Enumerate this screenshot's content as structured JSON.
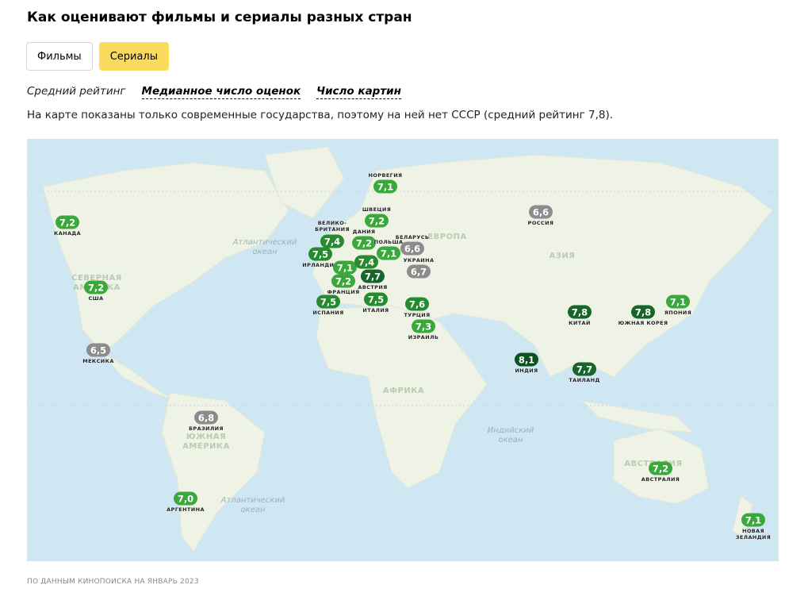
{
  "title": "Как оценивают фильмы и сериалы разных стран",
  "tabs": [
    {
      "label": "Фильмы",
      "active": false
    },
    {
      "label": "Сериалы",
      "active": true
    }
  ],
  "metrics": [
    {
      "label": "Средний рейтинг",
      "current": true
    },
    {
      "label": "Медианное число оценок",
      "current": false
    },
    {
      "label": "Число картин",
      "current": false
    }
  ],
  "note": "На карте показаны только современные государства, поэтому на ней нет СССР (средний рейтинг 7,8).",
  "source": "ПО ДАННЫМ КИНОПОИСКА НА ЯНВАРЬ 2023",
  "colors": {
    "low": "#8c8c8c",
    "mid": "#3ba83b",
    "high": "#268a2e",
    "top": "#17652a",
    "max": "#0f5222"
  },
  "map_labels": {
    "atlantic_n": "Атлантический\nокеан",
    "atlantic_s": "Атлантический\nокеан",
    "indian": "Индийский\nокеан",
    "europe": "ЕВРОПА",
    "asia": "АЗИЯ",
    "africa": "АФРИКА",
    "n_america": "СЕВЕРНАЯ\nАМЕРИКА",
    "s_america": "ЮЖНАЯ\nАМЕРИКА",
    "australia_c": "АВСТРАЛИЯ"
  },
  "countries": [
    {
      "id": "norway",
      "name": "НОРВЕГИЯ",
      "rating": "7,1"
    },
    {
      "id": "canada",
      "name": "КАНАДА",
      "rating": "7,2"
    },
    {
      "id": "sweden",
      "name": "ШВЕЦИЯ",
      "rating": "7,2"
    },
    {
      "id": "russia",
      "name": "РОССИЯ",
      "rating": "6,6"
    },
    {
      "id": "uk",
      "name": "ВЕЛИКО-\nБРИТАНИЯ",
      "rating": "7,4"
    },
    {
      "id": "denmark",
      "name": "ДАНИЯ",
      "rating": "7,2"
    },
    {
      "id": "poland",
      "name": "ПОЛЬША",
      "rating": "7,1"
    },
    {
      "id": "belarus",
      "name": "БЕЛАРУСЬ",
      "rating": "6,6"
    },
    {
      "id": "ireland",
      "name": "ИРЛАНДИЯ",
      "rating": "7,5"
    },
    {
      "id": "ukraine",
      "name": "УКРАИНА",
      "rating": "6,7"
    },
    {
      "id": "belgium",
      "name": "",
      "rating": "7,1"
    },
    {
      "id": "germany",
      "name": "",
      "rating": "7,4"
    },
    {
      "id": "austria",
      "name": "АВСТРИЯ",
      "rating": "7,7"
    },
    {
      "id": "france",
      "name": "ФРАНЦИЯ",
      "rating": "7,2"
    },
    {
      "id": "spain",
      "name": "ИСПАНИЯ",
      "rating": "7,5"
    },
    {
      "id": "italy",
      "name": "ИТАЛИЯ",
      "rating": "7,5"
    },
    {
      "id": "turkey",
      "name": "ТУРЦИЯ",
      "rating": "7,6"
    },
    {
      "id": "israel",
      "name": "ИЗРАИЛЬ",
      "rating": "7,3"
    },
    {
      "id": "usa",
      "name": "США",
      "rating": "7,2"
    },
    {
      "id": "mexico",
      "name": "МЕКСИКА",
      "rating": "6,5"
    },
    {
      "id": "china",
      "name": "КИТАЙ",
      "rating": "7,8"
    },
    {
      "id": "skorea",
      "name": "ЮЖНАЯ КОРЕЯ",
      "rating": "7,8"
    },
    {
      "id": "japan",
      "name": "ЯПОНИЯ",
      "rating": "7,1"
    },
    {
      "id": "india",
      "name": "ИНДИЯ",
      "rating": "8,1"
    },
    {
      "id": "thailand",
      "name": "ТАИЛАНД",
      "rating": "7,7"
    },
    {
      "id": "brazil",
      "name": "БРАЗИЛИЯ",
      "rating": "6,8"
    },
    {
      "id": "argentina",
      "name": "АРГЕНТИНА",
      "rating": "7,0"
    },
    {
      "id": "australia",
      "name": "АВСТРАЛИЯ",
      "rating": "7,2"
    },
    {
      "id": "nz",
      "name": "НОВАЯ\nЗЕЛАНДИЯ",
      "rating": "7,1"
    }
  ]
}
